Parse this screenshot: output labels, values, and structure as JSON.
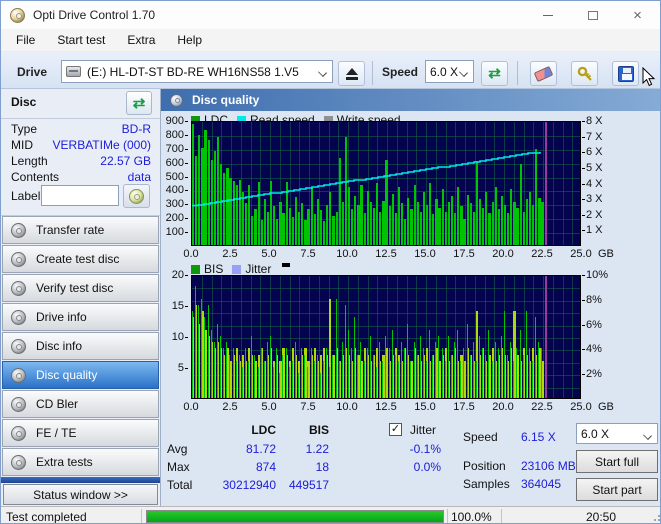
{
  "window": {
    "title": "Opti Drive Control 1.70"
  },
  "menu": [
    "File",
    "Start test",
    "Extra",
    "Help"
  ],
  "toolbar": {
    "drive_label": "Drive",
    "drive_value": "(E:)   HL-DT-ST BD-RE   WH16NS58 1.V5",
    "speed_label": "Speed",
    "speed_value": "6.0 X"
  },
  "sidebar": {
    "disc": {
      "title": "Disc",
      "fields": [
        {
          "label": "Type",
          "value": "BD-R"
        },
        {
          "label": "MID",
          "value": "VERBATIMe (000)"
        },
        {
          "label": "Length",
          "value": "22.57 GB"
        },
        {
          "label": "Contents",
          "value": "data"
        }
      ],
      "label_row": {
        "label": "Label",
        "value": ""
      }
    },
    "buttons": [
      {
        "label": "Transfer rate",
        "selected": false
      },
      {
        "label": "Create test disc",
        "selected": false
      },
      {
        "label": "Verify test disc",
        "selected": false
      },
      {
        "label": "Drive info",
        "selected": false
      },
      {
        "label": "Disc info",
        "selected": false
      },
      {
        "label": "Disc quality",
        "selected": true
      },
      {
        "label": "CD Bler",
        "selected": false
      },
      {
        "label": "FE / TE",
        "selected": false
      },
      {
        "label": "Extra tests",
        "selected": false
      }
    ],
    "status_button": "Status window >>"
  },
  "panel": {
    "title": "Disc quality"
  },
  "results": {
    "col_ldc": "LDC",
    "col_bis": "BIS",
    "row_avg": "Avg",
    "row_max": "Max",
    "row_total": "Total",
    "ldc": {
      "avg": "81.72",
      "max": "874",
      "total": "30212940"
    },
    "bis": {
      "avg": "1.22",
      "max": "18",
      "total": "449517"
    },
    "jitter": {
      "label": "Jitter",
      "checked": "✓",
      "avg": "-0.1%",
      "max": "0.0%"
    },
    "speed_label": "Speed",
    "speed_value": "6.15 X",
    "position_label": "Position",
    "position_value": "23106 MB",
    "samples_label": "Samples",
    "samples_value": "364045",
    "speed_select": "6.0 X",
    "start_full": "Start full",
    "start_part": "Start part"
  },
  "statusbar": {
    "text": "Test completed",
    "percent": "100.0%",
    "time": "20:50"
  },
  "colors": {
    "value_blue": "#1c1cd8",
    "plot_bg": "#04044e",
    "bar_green": "#00c403",
    "jitter_bar": "#b2d80a",
    "read_speed_cyan": "#00eaea",
    "cursor_magenta": "#9c3a9c",
    "progress_green": "#00a818"
  },
  "chart_data": [
    {
      "type": "bar",
      "title": "Disc quality - LDC vs Read speed",
      "xlim": [
        0,
        25
      ],
      "data_end_x": 22.6,
      "x_unit": "GB",
      "xticks": [
        0,
        2.5,
        5,
        7.5,
        10,
        12.5,
        15,
        17.5,
        20,
        22.5,
        25
      ],
      "ylim_left": [
        0,
        900
      ],
      "yticks_left": [
        900,
        800,
        700,
        600,
        500,
        400,
        300,
        200,
        100
      ],
      "ylim_right": [
        0,
        8
      ],
      "yticks_right": [
        {
          "v": 8,
          "label": "8 X"
        },
        {
          "v": 7,
          "label": "7 X"
        },
        {
          "v": 6,
          "label": "6 X"
        },
        {
          "v": 5,
          "label": "5 X"
        },
        {
          "v": 4,
          "label": "4 X"
        },
        {
          "v": 3,
          "label": "3 X"
        },
        {
          "v": 2,
          "label": "2 X"
        },
        {
          "v": 1,
          "label": "1 X"
        }
      ],
      "grid_x_divs": 40,
      "grid_y_divs": 9,
      "cursor_x": 22.65,
      "cursor_color": "#9c3a9c",
      "series": [
        {
          "name": "LDC",
          "color": "#00c403",
          "legend_color": "#0c9a0c",
          "values": [
            868,
            640,
            795,
            700,
            828,
            755,
            610,
            680,
            775,
            585,
            520,
            555,
            480,
            460,
            430,
            465,
            385,
            300,
            430,
            210,
            260,
            455,
            180,
            335,
            240,
            460,
            280,
            190,
            310,
            230,
            455,
            270,
            200,
            345,
            235,
            300,
            180,
            260,
            410,
            220,
            330,
            250,
            170,
            290,
            380,
            210,
            240,
            628,
            310,
            775,
            420,
            260,
            350,
            290,
            435,
            230,
            390,
            310,
            270,
            450,
            240,
            320,
            610,
            280,
            370,
            230,
            420,
            300,
            190,
            340,
            260,
            430,
            310,
            240,
            380,
            290,
            450,
            220,
            330,
            270,
            400,
            240,
            310,
            350,
            230,
            415,
            280,
            190,
            360,
            300,
            240,
            605,
            330,
            270,
            380,
            230,
            310,
            420,
            260,
            350,
            290,
            230,
            400,
            310,
            270,
            585,
            240,
            330,
            380,
            290,
            690,
            340,
            310
          ]
        },
        {
          "name": "Read speed",
          "color": "#00eaea",
          "legend_color": "#00eaea",
          "line": true,
          "axis": "right",
          "y_start": 2.65,
          "y_end": 6.15
        },
        {
          "name": "Write speed",
          "color": "#909090",
          "legend_color": "#909090",
          "values": []
        }
      ]
    },
    {
      "type": "bar",
      "title": "Disc quality - BIS vs Jitter",
      "xlim": [
        0,
        25
      ],
      "data_end_x": 22.6,
      "x_unit": "GB",
      "xticks": [
        0,
        2.5,
        5,
        7.5,
        10,
        12.5,
        15,
        17.5,
        20,
        22.5,
        25
      ],
      "ylim_left": [
        0,
        20
      ],
      "yticks_left": [
        20,
        15,
        10,
        5
      ],
      "ylim_right": [
        0,
        10
      ],
      "yticks_right": [
        {
          "v": 10,
          "label": "10%"
        },
        {
          "v": 8,
          "label": "8%"
        },
        {
          "v": 6,
          "label": "6%"
        },
        {
          "v": 4,
          "label": "4%"
        },
        {
          "v": 2,
          "label": "2%"
        }
      ],
      "grid_x_divs": 40,
      "grid_y_divs": 10,
      "cursor_x": 22.65,
      "cursor_color": "#9c3a9c",
      "legend_mark": true,
      "series": [
        {
          "name": "BIS",
          "color": "#00c403",
          "legend_color": "#0c9a0c",
          "width_frac": 0.6,
          "values": [
            14,
            18,
            15,
            16,
            13,
            15,
            11,
            9,
            12,
            10,
            8,
            9,
            7,
            8,
            6,
            7,
            5,
            8,
            6,
            10,
            7,
            5,
            8,
            6,
            9,
            10,
            5,
            8,
            4,
            7,
            8,
            5,
            6,
            9,
            4,
            8,
            7,
            5,
            8,
            6,
            7,
            4,
            6,
            8,
            5,
            7,
            16,
            6,
            9,
            15,
            11,
            8,
            13,
            7,
            9,
            6,
            8,
            10,
            7,
            5,
            9,
            6,
            10,
            8,
            11,
            7,
            6,
            9,
            8,
            12,
            6,
            9,
            7,
            10,
            8,
            6,
            11,
            7,
            9,
            10,
            8,
            6,
            10,
            7,
            9,
            11,
            6,
            8,
            12,
            7,
            9,
            6,
            10,
            8,
            7,
            11,
            6,
            9,
            8,
            10,
            14,
            7,
            9,
            6,
            8,
            11,
            7,
            14,
            8,
            6,
            13,
            9,
            8
          ]
        },
        {
          "name": "Jitter",
          "color": "#b2d80a",
          "legend_color": "#9aa0f8",
          "width_frac": 1,
          "values": [
            13,
            15,
            12,
            14,
            11,
            10,
            9,
            8,
            9,
            8,
            7,
            8,
            6,
            7,
            8,
            6,
            7,
            6,
            8,
            7,
            6,
            7,
            8,
            6,
            7,
            8,
            6,
            7,
            6,
            8,
            7,
            6,
            8,
            7,
            6,
            7,
            8,
            6,
            7,
            8,
            6,
            7,
            8,
            7,
            16,
            7,
            8,
            6,
            7,
            8,
            7,
            6,
            8,
            7,
            6,
            8,
            7,
            6,
            7,
            8,
            6,
            7,
            8,
            6,
            7,
            8,
            7,
            6,
            8,
            7,
            6,
            8,
            7,
            6,
            7,
            8,
            6,
            7,
            8,
            6,
            7,
            8,
            6,
            7,
            8,
            6,
            7,
            6,
            8,
            7,
            6,
            14,
            7,
            8,
            6,
            7,
            8,
            6,
            7,
            8,
            7,
            6,
            8,
            14,
            7,
            6,
            8,
            7,
            6,
            8,
            7,
            8,
            6
          ]
        }
      ]
    }
  ]
}
